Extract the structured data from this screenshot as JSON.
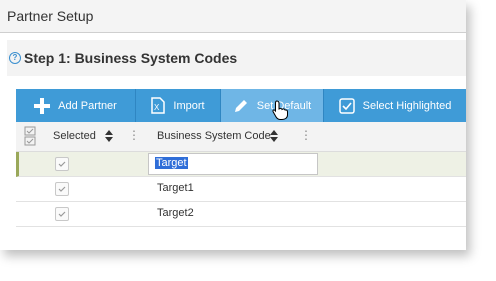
{
  "app": {
    "title": "Partner Setup"
  },
  "step": {
    "title": "Step 1: Business System Codes",
    "help_icon": "question-circle-icon"
  },
  "toolbar": {
    "add_partner": "Add Partner",
    "import": "Import",
    "set_default": "Set Default",
    "select_highlighted": "Select Highlighted"
  },
  "grid": {
    "columns": [
      "Selected",
      "Business System Code"
    ],
    "edit_value": "Target",
    "rows": [
      {
        "code": "Target",
        "selected": true
      },
      {
        "code": "Target1",
        "selected": true
      },
      {
        "code": "Target2",
        "selected": true
      }
    ]
  },
  "colors": {
    "toolbar": "#3f9bd7",
    "toolbar_active": "#6fb6e6",
    "selection": "#2f6ed8"
  }
}
